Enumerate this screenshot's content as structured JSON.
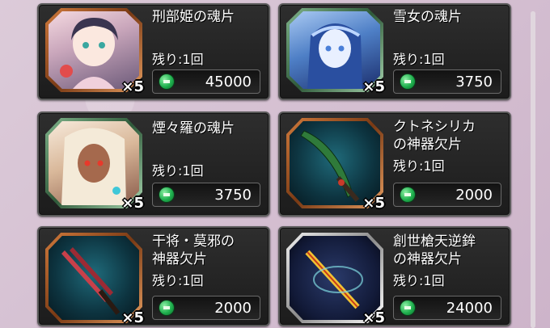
{
  "items": [
    {
      "name": "刑部姫の魂片",
      "remain": "残り:1回",
      "count": "×5",
      "price": "45000",
      "frame": "bronze",
      "art": "portrait-a"
    },
    {
      "name": "雪女の魂片",
      "remain": "残り:1回",
      "count": "×5",
      "price": "3750",
      "frame": "green",
      "art": "portrait-b"
    },
    {
      "name": "煙々羅の魂片",
      "remain": "残り:1回",
      "count": "×5",
      "price": "3750",
      "frame": "green",
      "art": "portrait-c"
    },
    {
      "name": "クトネシリカ\nの神器欠片",
      "remain": "残り:1回",
      "count": "×5",
      "price": "2000",
      "frame": "bronze",
      "art": "weapon-a"
    },
    {
      "name": "干将・莫邪の\n神器欠片",
      "remain": "残り:1回",
      "count": "×5",
      "price": "2000",
      "frame": "bronze",
      "art": "weapon-b"
    },
    {
      "name": "創世槍天逆鉾\nの神器欠片",
      "remain": "残り:1回",
      "count": "×5",
      "price": "24000",
      "frame": "silver",
      "art": "weapon-c"
    }
  ],
  "currency_icon": "green-coin-icon"
}
